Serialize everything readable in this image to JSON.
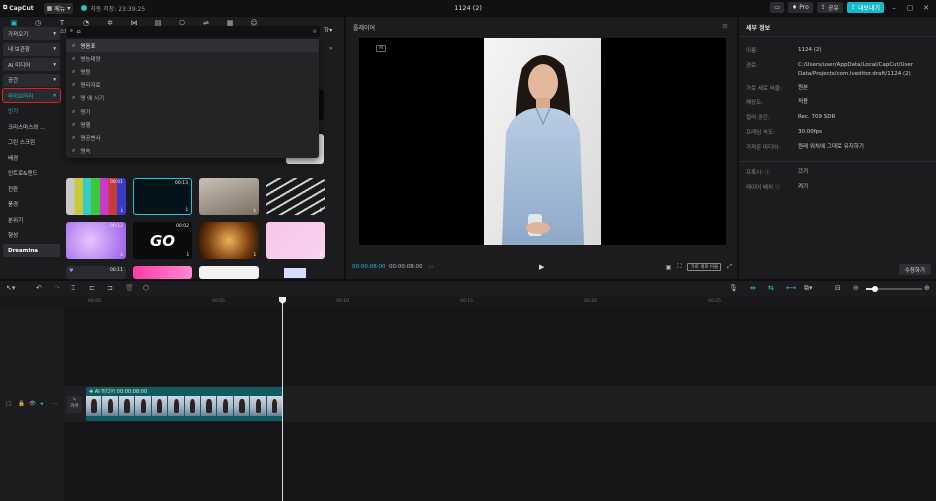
{
  "topbar": {
    "app_name": "CapCut",
    "menu_label": "메뉴",
    "autosave": "자동 저장: 23:39:25",
    "title": "1124 (2)",
    "pro": "Pro",
    "share": "공유",
    "export": "내보내기"
  },
  "categories": [
    {
      "label": "미디어",
      "icon": "media-icon"
    },
    {
      "label": "오디오",
      "icon": "audio-icon"
    },
    {
      "label": "텍스트",
      "icon": "text-icon"
    },
    {
      "label": "스티커",
      "icon": "sticker-icon"
    },
    {
      "label": "효과 효과",
      "icon": "effects-icon"
    },
    {
      "label": "전환",
      "icon": "transition-icon"
    },
    {
      "label": "캡션",
      "icon": "caption-icon"
    },
    {
      "label": "필터",
      "icon": "filter-icon"
    },
    {
      "label": "조정",
      "icon": "adjust-icon"
    },
    {
      "label": "템플릿",
      "icon": "template-icon"
    },
    {
      "label": "AI 아바타",
      "icon": "avatar-icon"
    }
  ],
  "side_nav": [
    {
      "label": "가져오기",
      "kind": "dd"
    },
    {
      "label": "내 보관함",
      "kind": "dd"
    },
    {
      "label": "AI 미디어",
      "kind": "dd"
    },
    {
      "label": "공간",
      "kind": "dd"
    },
    {
      "label": "라이브러리",
      "kind": "sel"
    },
    {
      "label": "인기",
      "kind": "on"
    },
    {
      "label": "크리스마스와 ...",
      "kind": ""
    },
    {
      "label": "그린 스크린",
      "kind": ""
    },
    {
      "label": "배경",
      "kind": ""
    },
    {
      "label": "인트로&엔드",
      "kind": ""
    },
    {
      "label": "전환",
      "kind": ""
    },
    {
      "label": "풍경",
      "kind": ""
    },
    {
      "label": "분위기",
      "kind": ""
    },
    {
      "label": "형성",
      "kind": ""
    },
    {
      "label": "Dreamina",
      "kind": "pill"
    }
  ],
  "search": {
    "value": "ㅁ",
    "filter_label": "Tr"
  },
  "suggestions": [
    "명음표",
    "명능태양",
    "명원",
    "명리자료",
    "명 애 시기",
    "명기",
    "명행",
    "명공변사",
    "명속"
  ],
  "thumbnails": [
    {
      "dur": "00:01"
    },
    {
      "dur": "00:13"
    },
    {
      "dur": ""
    },
    {
      "dur": ""
    },
    {
      "dur": "00:12"
    },
    {
      "dur": "00:02",
      "text": "GO"
    },
    {
      "dur": ""
    },
    {
      "dur": ""
    },
    {
      "dur": "00:11"
    },
    {
      "dur": ""
    },
    {
      "dur": ""
    },
    {
      "dur": ""
    }
  ],
  "player": {
    "header": "플레이어",
    "ai_tag": "AI",
    "time_current": "00:00:08:00",
    "time_total": "00:00:08:00",
    "ratio": "가로 세로 비율"
  },
  "details": {
    "header": "세부 정보",
    "rows": [
      {
        "k": "이름:",
        "v": "1124 (2)"
      },
      {
        "k": "경로:",
        "v": "C:/Users/user/AppData/Local/CapCut/User Data/Projects/com.lveditor.draft/1124 (2)"
      },
      {
        "k": "가로 세로 비율:",
        "v": "원본"
      },
      {
        "k": "해상도:",
        "v": "적용"
      },
      {
        "k": "컬러 공간:",
        "v": "Rec. 709 SDR"
      },
      {
        "k": "프레임 속도:",
        "v": "30.00fps"
      },
      {
        "k": "가져온 미디어:",
        "v": "원래 위치에 그대로 유지하기"
      },
      {
        "k": "프록시: ⓘ",
        "v": "끄기"
      },
      {
        "k": "레이어 배치 ⓘ",
        "v": "켜기"
      }
    ],
    "edit_button": "수정하기"
  },
  "timeline": {
    "ticks": [
      "00:00",
      "00:05",
      "00:10",
      "00:15",
      "00:20",
      "00:25"
    ],
    "clip_label": "AI 미디어  00:00:08:00",
    "cover_label": "커버"
  }
}
